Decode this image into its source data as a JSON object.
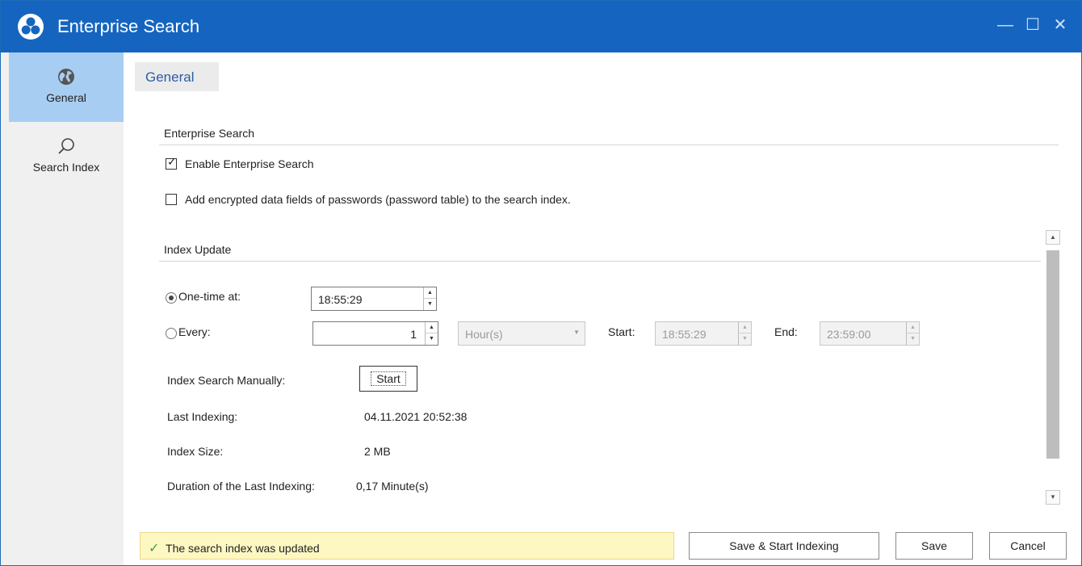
{
  "window": {
    "title": "Enterprise Search",
    "minimize_glyph": "—",
    "maximize_glyph": "☐",
    "close_glyph": "✕",
    "title_bar_color": "#1565c0"
  },
  "sidebar": {
    "items": [
      {
        "label": "General",
        "icon": "globe-icon",
        "active": true
      },
      {
        "label": "Search Index",
        "icon": "search-icon",
        "active": false
      }
    ],
    "active_color": "#a8cdf2"
  },
  "tab": {
    "label": "General"
  },
  "enterprise_search": {
    "heading": "Enterprise Search",
    "enable_label": "Enable Enterprise Search",
    "enable_checked": true,
    "encrypted_label": "Add encrypted data fields of passwords (password table) to the search index.",
    "encrypted_checked": false
  },
  "index_update": {
    "heading": "Index Update",
    "onetime_label": "One-time at:",
    "onetime_selected": true,
    "onetime_value": "18:55:29",
    "every_label": "Every:",
    "every_selected": false,
    "every_value": "1",
    "unit_value": "Hour(s)",
    "start_label": "Start:",
    "start_value": "18:55:29",
    "end_label": "End:",
    "end_value": "23:59:00",
    "manual_label": "Index Search Manually:",
    "start_button": "Start",
    "last_indexing_label": "Last Indexing:",
    "last_indexing_value": "04.11.2021 20:52:38",
    "index_size_label": "Index Size:",
    "index_size_value": "2 MB",
    "duration_label": "Duration of the Last Indexing:",
    "duration_value": "0,17 Minute(s)"
  },
  "footer": {
    "status_text": "The search index was updated",
    "save_start_button": "Save & Start Indexing",
    "save_button": "Save",
    "cancel_button": "Cancel"
  }
}
